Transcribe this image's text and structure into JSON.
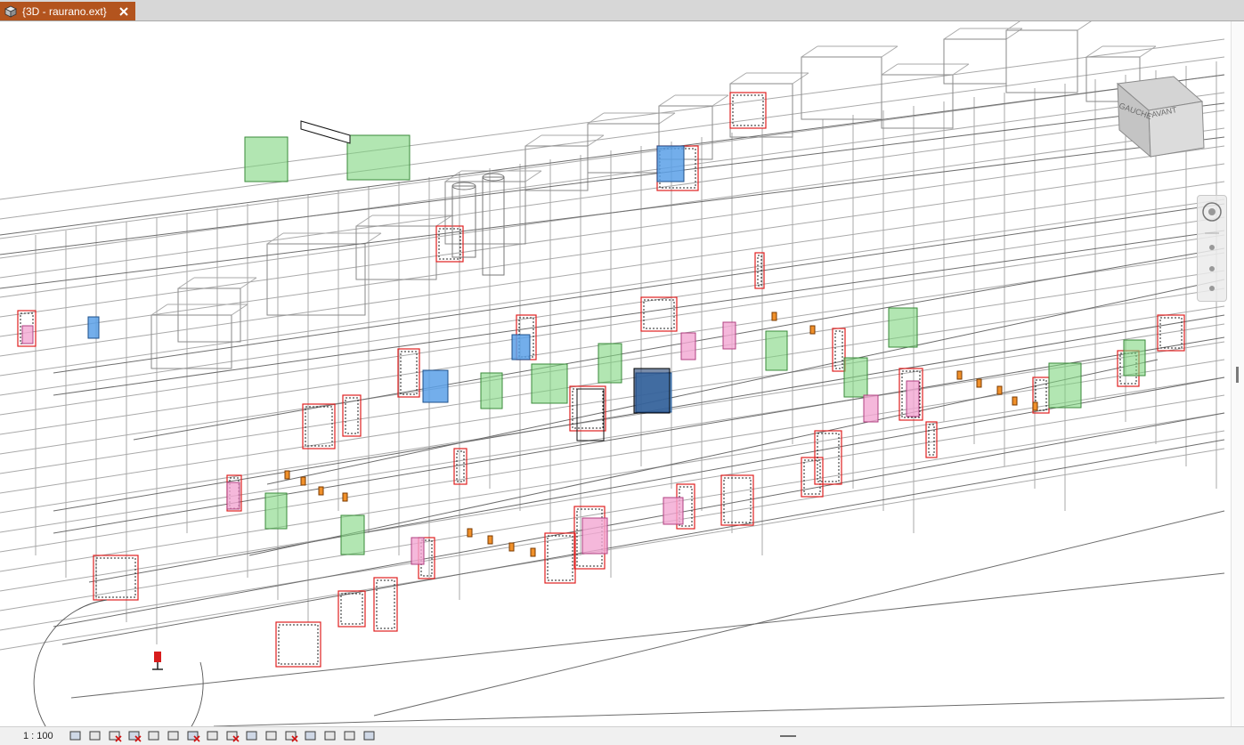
{
  "tab": {
    "title": "{3D - raurano.ext}",
    "icon": "cube-3d-icon",
    "close_icon": "close-icon",
    "color": "#b3541e"
  },
  "viewport": {
    "model_text": [
      "GAUCHE",
      "AVANT"
    ],
    "colors": {
      "line": "#9a9a9a",
      "dark_line": "#555555",
      "door_red": "#e02020",
      "glass_green": "#7fd67f",
      "panel_blue": "#5aa0e8",
      "panel_pink": "#f2a6d2",
      "marker_orange": "#f0902a"
    }
  },
  "statusbar": {
    "scale": "1 : 100",
    "tools": [
      "detail-level-icon",
      "visual-style-icon",
      "sun-path-icon",
      "shadows-icon",
      "render-icon",
      "crop-view-icon",
      "show-crop-icon",
      "unlock-3d-view-icon",
      "temporary-hide-icon",
      "reveal-hidden-icon",
      "worksharing-icon",
      "highlight-displacement-icon",
      "reveal-constraints-icon",
      "analytical-model-icon",
      "temporary-view-properties-icon",
      "section-box-icon"
    ]
  }
}
